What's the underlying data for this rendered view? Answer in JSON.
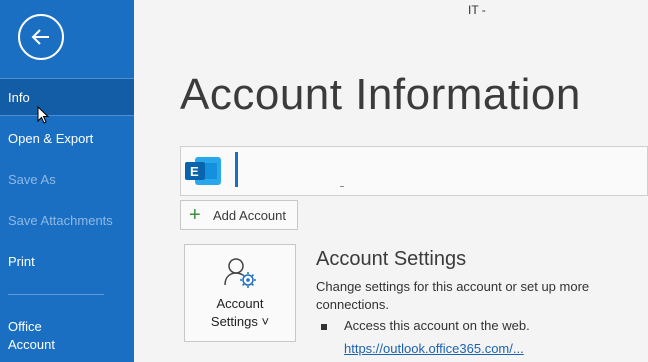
{
  "window": {
    "title_fragment": "IT -"
  },
  "sidebar": {
    "items": [
      {
        "label": "Info"
      },
      {
        "label": "Open & Export"
      },
      {
        "label": "Save As"
      },
      {
        "label": "Save Attachments"
      },
      {
        "label": "Print"
      }
    ],
    "office_account_line1": "Office",
    "office_account_line2": "Account"
  },
  "main": {
    "title": "Account Information",
    "add_account_label": "Add Account",
    "settings_tile": {
      "line1": "Account",
      "line2": "Settings ˅"
    },
    "account_settings": {
      "title": "Account Settings",
      "description": "Change settings for this account or set up more connections.",
      "bullet": "Access this account on the web.",
      "link": "https://outlook.office365.com/..."
    }
  },
  "colors": {
    "sidebar": "#1a6fc2",
    "accent": "#1a6fc2",
    "link": "#1b62b0"
  }
}
